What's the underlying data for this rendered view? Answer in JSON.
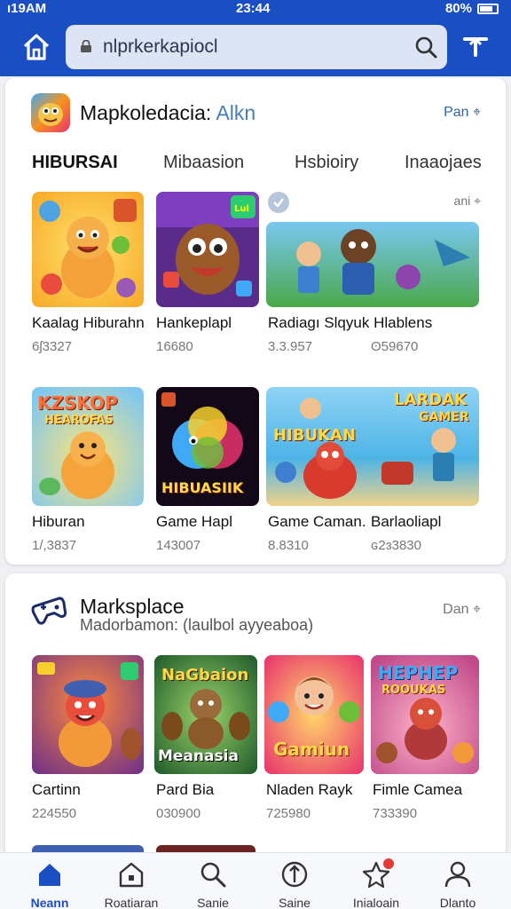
{
  "status": {
    "time_left": "ı19AM",
    "time_center": "23:44",
    "battery": "80%"
  },
  "address_bar": {
    "url": "nlprkerkapiocl"
  },
  "section1": {
    "title": "Mapkoledacia:",
    "title_suffix": "Alkn",
    "see_more": "Pan",
    "tabs": [
      "HIBURSAI",
      "Mibaasion",
      "Hsbioiry",
      "Inaaojaes"
    ],
    "corner_label": "ani",
    "tiles": [
      {
        "name": "Kaalag Hiburahn",
        "count": "6ʃ3327"
      },
      {
        "name": "Hankeplapl",
        "count": "16680"
      },
      {
        "name": "Radiagı Slqyuk Hlablens",
        "count": "3.3.957",
        "count_alt": "ʘ59670"
      },
      {
        "name": "Hiburan",
        "count": "1/,3837",
        "art_text": "KZSKOP",
        "art_text2": "HEAROFAS"
      },
      {
        "name": "Game Hapl",
        "count": "143007",
        "art_text": "HIBUASIIK"
      },
      {
        "name": "Game Caman.",
        "count": "8.8310",
        "name_alt": "Barlaoliapl",
        "count_alt": "ɢ2ɜ3830",
        "art_text": "HIBUKAN",
        "art_text2": "LARDAK",
        "art_text3": "GAMER"
      }
    ]
  },
  "section2": {
    "title": "Marksplace",
    "subtitle": "Madorbamon: (laulbol ayyeaboa)",
    "see_more": "Dan",
    "tiles": [
      {
        "name": "Cartinn",
        "count": "224550"
      },
      {
        "name": "Pard Bia",
        "count": "030900",
        "art_text": "NaGbaion",
        "art_text2": "Meanasia"
      },
      {
        "name": "Nladen Rayk",
        "count": "725980",
        "art_text": "Gamiun"
      },
      {
        "name": "Fimle Camea",
        "count": "733390",
        "art_text": "HEPHEP",
        "art_text2": "ROOUKAS"
      }
    ]
  },
  "nav": [
    {
      "label": "Neann",
      "icon": "home-icon"
    },
    {
      "label": "Roatiaran",
      "icon": "store-icon"
    },
    {
      "label": "Sanie",
      "icon": "search-icon"
    },
    {
      "label": "Saine",
      "icon": "compass-icon"
    },
    {
      "label": "Inialoain",
      "icon": "star-icon"
    },
    {
      "label": "Dlanto",
      "icon": "profile-icon"
    }
  ],
  "colors": {
    "appbar": "#1a4fc4",
    "accent": "#2e66a8",
    "notification": "#e53935"
  }
}
